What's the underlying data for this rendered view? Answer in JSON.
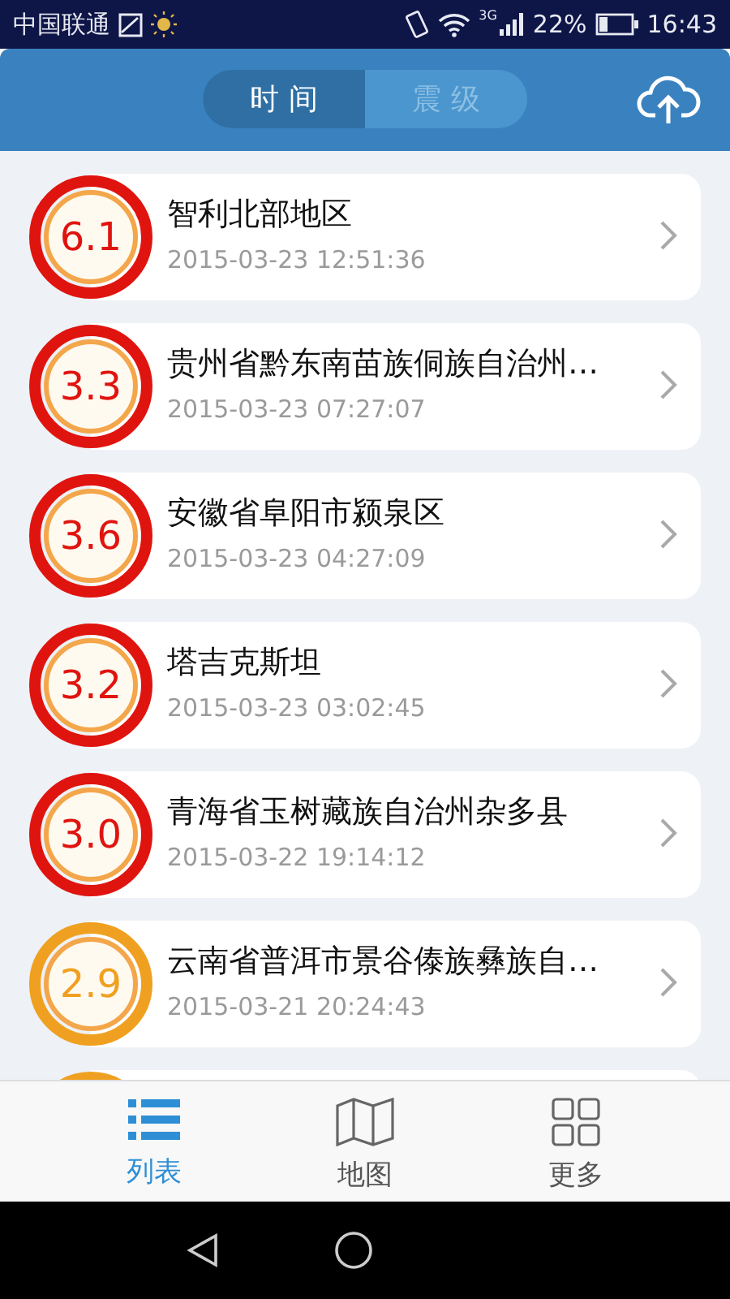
{
  "status_bar": {
    "carrier": "中国联通",
    "network": "3G",
    "battery": "22%",
    "time": "16:43"
  },
  "header": {
    "segments": [
      {
        "label": "时间",
        "selected": true
      },
      {
        "label": "震级",
        "selected": false
      }
    ]
  },
  "quakes": [
    {
      "magnitude": "6.1",
      "place": "智利北部地区",
      "time": "2015-03-23 12:51:36",
      "color": "#e0140f"
    },
    {
      "magnitude": "3.3",
      "place": "贵州省黔东南苗族侗族自治州…",
      "time": "2015-03-23 07:27:07",
      "color": "#e0140f"
    },
    {
      "magnitude": "3.6",
      "place": "安徽省阜阳市颍泉区",
      "time": "2015-03-23 04:27:09",
      "color": "#e0140f"
    },
    {
      "magnitude": "3.2",
      "place": "塔吉克斯坦",
      "time": "2015-03-23 03:02:45",
      "color": "#e0140f"
    },
    {
      "magnitude": "3.0",
      "place": "青海省玉树藏族自治州杂多县",
      "time": "2015-03-22 19:14:12",
      "color": "#e0140f"
    },
    {
      "magnitude": "2.9",
      "place": "云南省普洱市景谷傣族彝族自…",
      "time": "2015-03-21 20:24:43",
      "color": "#f0a020"
    },
    {
      "color": "#f0a020"
    }
  ],
  "tab_bar": [
    {
      "label": "列表",
      "kind": "list",
      "selected": true
    },
    {
      "label": "地图",
      "kind": "map",
      "selected": false
    },
    {
      "label": "更多",
      "kind": "grid",
      "selected": false
    }
  ]
}
